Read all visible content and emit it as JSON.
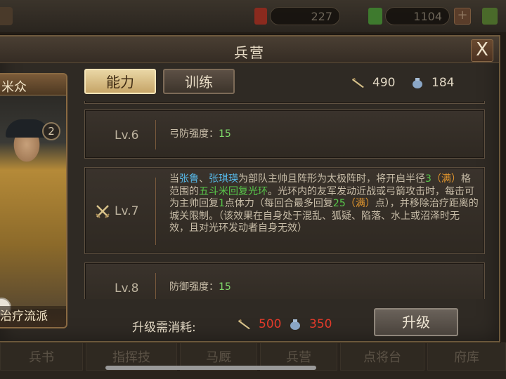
{
  "top_bar": {
    "resource1_value": "227",
    "resource2_value": "1104",
    "plus_label": "+"
  },
  "bottom_menu": {
    "tabs": [
      "兵书",
      "指挥技",
      "马厩",
      "兵营",
      "点将台",
      "府库"
    ]
  },
  "dialog": {
    "title": "兵营",
    "close_label": "X"
  },
  "hero": {
    "name": "米众",
    "level_badge": "2",
    "school": "治疗流派"
  },
  "tabs": [
    {
      "label": "能力",
      "active": true
    },
    {
      "label": "训练",
      "active": false
    }
  ],
  "currencies": {
    "weapon_value": "490",
    "bag_value": "184"
  },
  "levels": [
    {
      "label": "Lv.6",
      "text_prefix": "弓防强度：",
      "value": "15"
    },
    {
      "label": "Lv.7",
      "segments": [
        {
          "t": "当",
          "c": ""
        },
        {
          "t": "张鲁",
          "c": "blue"
        },
        {
          "t": "、",
          "c": ""
        },
        {
          "t": "张琪瑛",
          "c": "blue"
        },
        {
          "t": "为部队主帅且阵形为太极阵时，将开启半径",
          "c": ""
        },
        {
          "t": "3",
          "c": "green"
        },
        {
          "t": "（满）",
          "c": "orange"
        },
        {
          "t": "格范围的",
          "c": ""
        },
        {
          "t": "五斗米回复光环",
          "c": "green"
        },
        {
          "t": "。光环内的友军发动近战或弓箭攻击时，每击可为主帅回复",
          "c": ""
        },
        {
          "t": "1",
          "c": "green"
        },
        {
          "t": "点体力（每回合最多回复",
          "c": ""
        },
        {
          "t": "25",
          "c": "green"
        },
        {
          "t": "（满）",
          "c": "orange"
        },
        {
          "t": "点），并移除治疗距离的城关限制。（该效果在自身处于混乱、狐疑、陷落、水上或沼泽时无效，且对光环发动者自身无效）",
          "c": ""
        }
      ]
    },
    {
      "label": "Lv.8",
      "text_prefix": "防御强度：",
      "value": "15"
    }
  ],
  "upgrade": {
    "cost_label": "升级需消耗:",
    "weapon_cost": "500",
    "bag_cost": "350",
    "button_label": "升级"
  }
}
